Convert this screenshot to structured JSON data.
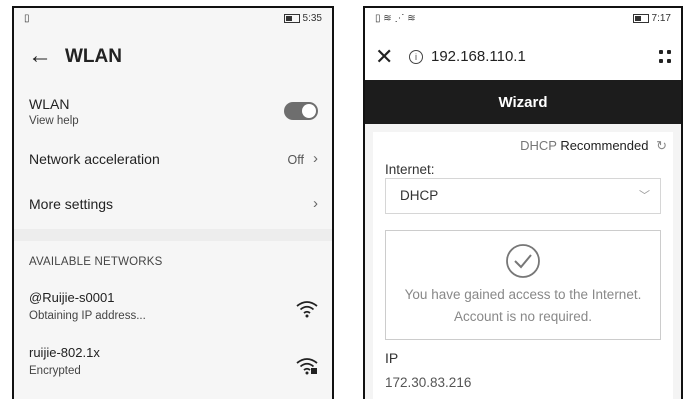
{
  "left": {
    "status": {
      "left_icon": "sim-icon",
      "battery_icon": "battery-icon",
      "time": "5:35"
    },
    "appbar": {
      "back_icon": "back-arrow-icon",
      "title": "WLAN"
    },
    "wlan": {
      "label": "WLAN",
      "sub": "View help",
      "toggle_on": true
    },
    "network_acceleration": {
      "label": "Network acceleration",
      "value": "Off"
    },
    "more_settings": {
      "label": "More settings"
    },
    "section_header": "AVAILABLE NETWORKS",
    "networks": [
      {
        "ssid": "@Ruijie-s0001",
        "status": "Obtaining IP address...",
        "icon": "wifi-icon"
      },
      {
        "ssid": "ruijie-802.1x",
        "status": "Encrypted",
        "icon": "wifi-lock-icon"
      }
    ]
  },
  "right": {
    "status": {
      "time": "7:17"
    },
    "url_bar": {
      "close_icon": "close-icon",
      "info_icon": "info-icon",
      "url": "192.168.110.1",
      "menu_icon": "more-icon"
    },
    "wizard_title": "Wizard",
    "dhcp_muted": "DHCP",
    "dhcp_recommended": "Recommended",
    "internet_label": "Internet:",
    "internet_select_value": "DHCP",
    "message_line1": "You have gained access to the Internet.",
    "message_line2": "Account is no required.",
    "ip_label": "IP",
    "ip_value": "172.30.83.216"
  }
}
